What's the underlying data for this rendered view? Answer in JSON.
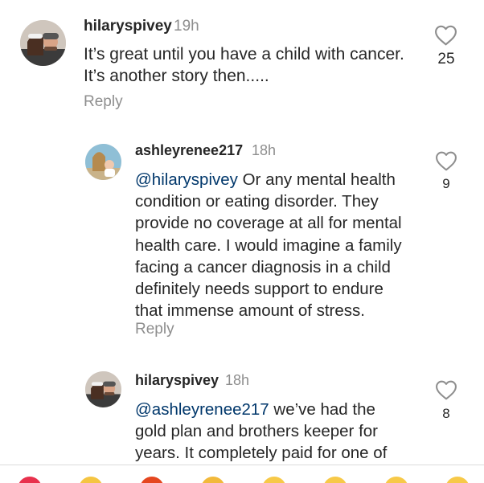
{
  "comments": [
    {
      "username": "hilaryspivey",
      "timestamp": "19h",
      "lines": [
        "It’s great until you have a child with cancer.",
        "It’s another story then....."
      ],
      "reply_label": "Reply",
      "likes": "25"
    },
    {
      "username": "ashleyrenee217",
      "timestamp": "18h",
      "mention": "@hilaryspivey",
      "lines": [
        " Or any mental health",
        "condition or eating disorder. They",
        "provide no coverage at all for mental",
        "health care. I would imagine a family",
        "facing a cancer diagnosis in a child",
        "definitely needs support to endure",
        "that immense amount of stress."
      ],
      "reply_label": "Reply",
      "likes": "9"
    },
    {
      "username": "hilaryspivey",
      "timestamp": "18h",
      "mention": "@ashleyrenee217",
      "lines": [
        " we’ve had the",
        "gold plan and brothers keeper for",
        "years. It completely paid for one of"
      ],
      "likes": "8"
    }
  ],
  "icons": {
    "like": "heart-outline-icon",
    "reactions": [
      "red-heart-emoji-icon",
      "raised-hands-emoji-icon",
      "fire-emoji-icon",
      "clapping-emoji-icon",
      "crying-face-emoji-icon",
      "heart-eyes-emoji-icon",
      "surprised-face-emoji-icon",
      "laughing-face-emoji-icon"
    ]
  },
  "colors": {
    "text": "#262626",
    "secondary": "#8e8e8e",
    "mention": "#00376b",
    "background": "#ffffff"
  }
}
